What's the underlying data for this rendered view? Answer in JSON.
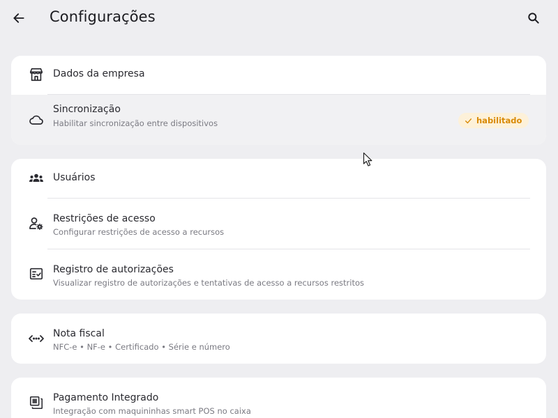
{
  "header": {
    "title": "Configurações"
  },
  "groups": [
    {
      "items": [
        {
          "title": "Dados da empresa",
          "icon": "storefront-icon"
        },
        {
          "title": "Sincronização",
          "subtitle": "Habilitar sincronização entre dispositivos",
          "icon": "cloud-icon",
          "badge": {
            "label": "habilitado",
            "icon": "check-icon",
            "color": "#d98a06",
            "background": "#fdf1d9"
          }
        }
      ]
    },
    {
      "items": [
        {
          "title": "Usuários",
          "icon": "users-group-icon"
        },
        {
          "title": "Restrições de acesso",
          "subtitle": "Configurar restrições de acesso a recursos",
          "icon": "user-settings-icon"
        },
        {
          "title": "Registro de autorizações",
          "subtitle": "Visualizar registro de autorizações e tentativas de acesso a recursos restritos",
          "icon": "checklist-icon"
        }
      ]
    },
    {
      "items": [
        {
          "title": "Nota fiscal",
          "subtitle": "NFC-e  •  NF-e  •  Certificado  •  Série e número",
          "icon": "code-arrows-icon"
        }
      ]
    },
    {
      "items": [
        {
          "title": "Pagamento Integrado",
          "subtitle": "Integração com maquininhas smart POS no caixa",
          "icon": "layers-icon"
        }
      ]
    }
  ],
  "colors": {
    "background": "#eeeef1",
    "card": "#ffffff",
    "accent": "#d98a06"
  }
}
